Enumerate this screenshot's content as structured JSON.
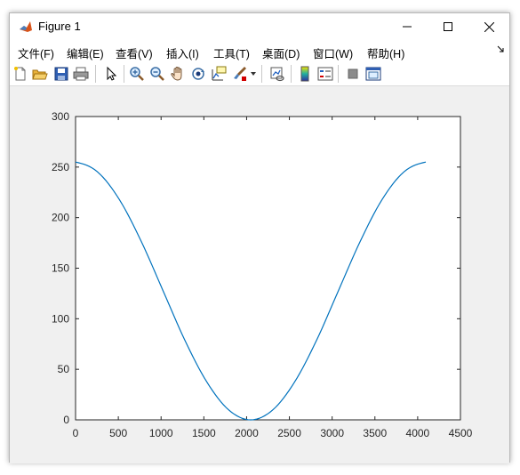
{
  "window": {
    "title": "Figure 1",
    "colors": {
      "frame_bg": "#f0f0f0",
      "axes_bg": "#ffffff",
      "line": "#0072bd"
    }
  },
  "menubar": {
    "items": [
      {
        "label": "文件(F)"
      },
      {
        "label": "编辑(E)"
      },
      {
        "label": "查看(V)"
      },
      {
        "label": "插入(I)"
      },
      {
        "label": "工具(T)"
      },
      {
        "label": "桌面(D)"
      },
      {
        "label": "窗口(W)"
      },
      {
        "label": "帮助(H)"
      }
    ],
    "overflow_icon": "chevron-icon"
  },
  "toolbar": {
    "icons": [
      "new-figure-icon",
      "open-file-icon",
      "save-icon",
      "print-icon",
      "pointer-icon",
      "zoom-in-icon",
      "zoom-out-icon",
      "pan-icon",
      "rotate-3d-icon",
      "data-cursor-icon",
      "brush-icon",
      "link-plot-icon",
      "colorbar-icon",
      "legend-icon",
      "hide-plot-tools-icon",
      "show-plot-tools-icon"
    ]
  },
  "chart_data": {
    "type": "line",
    "title": "",
    "xlabel": "",
    "ylabel": "",
    "xlim": [
      0,
      4500
    ],
    "ylim": [
      0,
      300
    ],
    "xticks": [
      0,
      500,
      1000,
      1500,
      2000,
      2500,
      3000,
      3500,
      4000,
      4500
    ],
    "yticks": [
      0,
      50,
      100,
      150,
      200,
      250,
      300
    ],
    "grid": false,
    "series": [
      {
        "x": [
          0,
          256,
          512,
          768,
          1024,
          1280,
          1536,
          1792,
          2048,
          2304,
          2560,
          2816,
          3072,
          3328,
          3584,
          3840,
          4095
        ],
        "y": [
          255,
          245.3,
          217.9,
          176.5,
          127.5,
          78.4,
          37.3,
          9.7,
          0,
          9.7,
          37.3,
          78.4,
          127.5,
          176.5,
          217.9,
          245.3,
          255
        ]
      }
    ]
  }
}
